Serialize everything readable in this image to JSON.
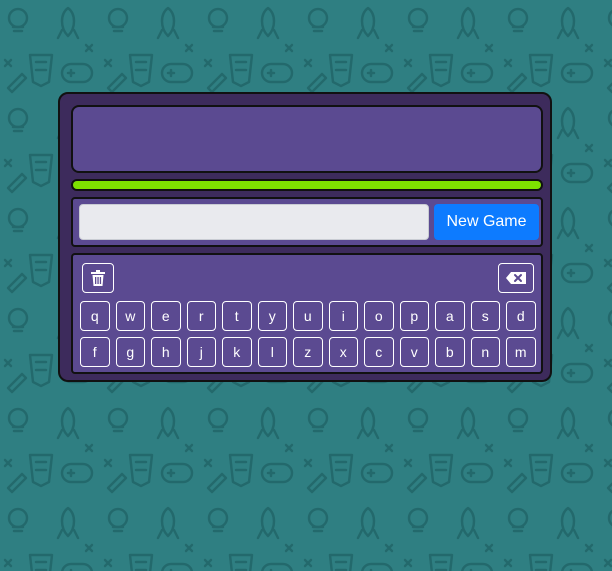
{
  "colors": {
    "background": "#2f7f82",
    "pattern": "#23696c",
    "panel": "#3d2b5c",
    "inner": "#5b4a91",
    "progress": "#7ee100",
    "button": "#0d7bff"
  },
  "display": {
    "text": ""
  },
  "progress": {
    "fraction": 1.0
  },
  "input": {
    "value": "",
    "placeholder": ""
  },
  "buttons": {
    "new_game_label": "New Game"
  },
  "icons": {
    "clear": "trash-icon",
    "delete": "backspace-icon"
  },
  "keyboard": {
    "row1": [
      "q",
      "w",
      "e",
      "r",
      "t",
      "y",
      "u",
      "i",
      "o",
      "p",
      "a",
      "s",
      "d"
    ],
    "row2": [
      "f",
      "g",
      "h",
      "j",
      "k",
      "l",
      "z",
      "x",
      "c",
      "v",
      "b",
      "n",
      "m"
    ]
  }
}
